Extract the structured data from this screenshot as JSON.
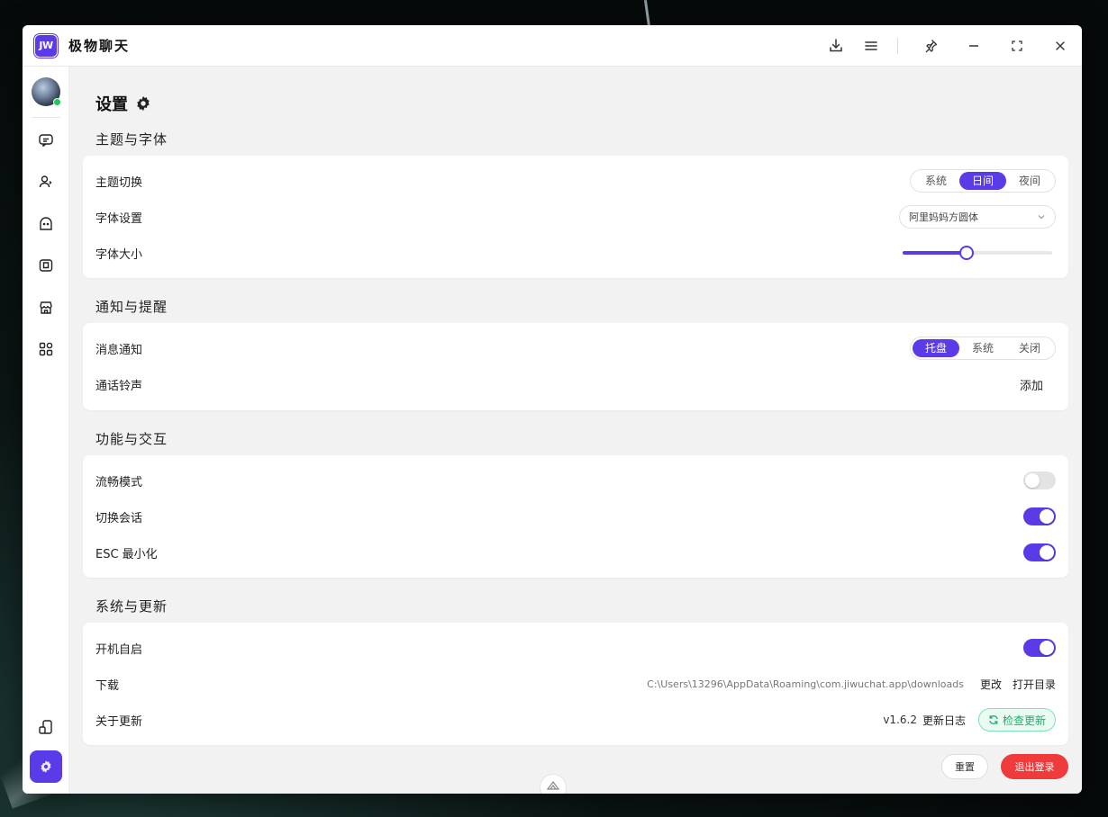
{
  "app": {
    "logo_text": "JW",
    "title": "极物聊天"
  },
  "titlebar": {
    "icons": [
      "download-icon",
      "menu-icon",
      "pin-icon",
      "minimize-icon",
      "maximize-icon",
      "close-icon"
    ]
  },
  "sidebar": {
    "items": [
      "chat-icon",
      "contacts-icon",
      "ghost-icon",
      "bookmark-icon",
      "store-icon",
      "apps-icon",
      "device-icon",
      "settings-icon"
    ]
  },
  "page": {
    "title": "设置"
  },
  "sections": {
    "theme": {
      "title": "主题与字体",
      "theme_label": "主题切换",
      "theme_options": [
        "系统",
        "日间",
        "夜间"
      ],
      "theme_selected": "日间",
      "font_label": "字体设置",
      "font_value": "阿里妈妈方圆体",
      "font_size_label": "字体大小",
      "font_size_level": 0.43
    },
    "notify": {
      "title": "通知与提醒",
      "message_label": "消息通知",
      "message_options": [
        "托盘",
        "系统",
        "关闭"
      ],
      "message_selected": "托盘",
      "ringtone_label": "通话铃声",
      "ringtone_action": "添加"
    },
    "features": {
      "title": "功能与交互",
      "smooth_label": "流畅模式",
      "smooth_on": false,
      "switch_label": "切换会话",
      "switch_on": true,
      "esc_label": "ESC 最小化",
      "esc_on": true
    },
    "system": {
      "title": "系统与更新",
      "autostart_label": "开机自启",
      "autostart_on": true,
      "download_label": "下载",
      "download_path": "C:\\Users\\13296\\AppData\\Roaming\\com.jiwuchat.app\\downloads",
      "change_label": "更改",
      "open_dir_label": "打开目录",
      "update_label": "关于更新",
      "version": "v1.6.2",
      "changelog_label": "更新日志",
      "check_update_label": "检查更新"
    }
  },
  "footer": {
    "reset_label": "重置",
    "logout_label": "退出登录"
  },
  "colors": {
    "accent": "#5b3be8",
    "danger": "#ef3b3b",
    "success": "#1eae6a"
  }
}
